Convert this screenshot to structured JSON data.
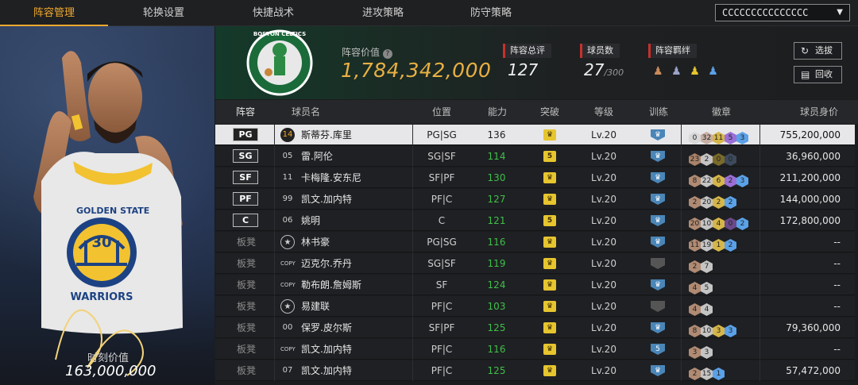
{
  "nav": {
    "tabs": [
      "阵容管理",
      "轮换设置",
      "快捷战术",
      "进攻策略",
      "防守策略"
    ],
    "active": 0,
    "team_select": "CCCCCCCCCCCCCCC"
  },
  "left_panel": {
    "moment_label": "时刻价值",
    "moment_value": "163,000,000"
  },
  "header": {
    "value_label": "阵容价值",
    "value": "1,784,342,000",
    "overall_label": "阵容总评",
    "overall": "127",
    "count_label": "球员数",
    "count": "27",
    "count_max": "/300",
    "chem_label": "阵容羁绊",
    "btn_pick": "选拔",
    "btn_recycle": "回收",
    "logo_text": "BOSTON CELTICS"
  },
  "columns": [
    "阵容",
    "球员名",
    "位置",
    "能力",
    "突破",
    "等级",
    "训练",
    "徽章",
    "球员身价"
  ],
  "rows": [
    {
      "slot": "PG",
      "type": "pos",
      "jersey": "14",
      "name": "斯蒂芬.库里",
      "pos": "PG|SG",
      "ability": "136",
      "ab_green": false,
      "bt": "♛",
      "level": "Lv.20",
      "train": "♛",
      "train_grey": false,
      "badges": [
        {
          "v": "0",
          "c": "#d8d8d8"
        },
        {
          "v": "32",
          "c": "#c9b0a4"
        },
        {
          "v": "11",
          "c": "#d6b648"
        },
        {
          "v": "5",
          "c": "#9b6fd6"
        },
        {
          "v": "3",
          "c": "#5aa1e8"
        }
      ],
      "worth": "755,200,000",
      "sel": true
    },
    {
      "slot": "SG",
      "type": "pos",
      "jersey": "05",
      "name": "雷.阿伦",
      "pos": "SG|SF",
      "ability": "114",
      "ab_green": true,
      "bt": "5",
      "level": "Lv.20",
      "train": "♛",
      "train_grey": false,
      "badges": [
        {
          "v": "23",
          "c": "#a8826a"
        },
        {
          "v": "2",
          "c": "#c4c4c4"
        },
        {
          "v": "0",
          "c": "#7a6a2a"
        },
        {
          "v": "0",
          "c": "#3c4a5c"
        }
      ],
      "worth": "36,960,000",
      "sel": false
    },
    {
      "slot": "SF",
      "type": "pos",
      "jersey": "11",
      "name": "卡梅隆.安东尼",
      "pos": "SF|PF",
      "ability": "130",
      "ab_green": true,
      "bt": "♛",
      "level": "Lv.20",
      "train": "♛",
      "train_grey": false,
      "badges": [
        {
          "v": "8",
          "c": "#b08a72"
        },
        {
          "v": "22",
          "c": "#c4c4c4"
        },
        {
          "v": "6",
          "c": "#d6b648"
        },
        {
          "v": "2",
          "c": "#9b6fd6"
        },
        {
          "v": "3",
          "c": "#5aa1e8"
        }
      ],
      "worth": "211,200,000",
      "sel": false
    },
    {
      "slot": "PF",
      "type": "pos",
      "jersey": "99",
      "name": "凯文.加内特",
      "pos": "PF|C",
      "ability": "127",
      "ab_green": true,
      "bt": "♛",
      "level": "Lv.20",
      "train": "♛",
      "train_grey": false,
      "badges": [
        {
          "v": "2",
          "c": "#b08a72"
        },
        {
          "v": "20",
          "c": "#c4c4c4"
        },
        {
          "v": "2",
          "c": "#d6b648"
        },
        {
          "v": "2",
          "c": "#5aa1e8"
        }
      ],
      "worth": "144,000,000",
      "sel": false
    },
    {
      "slot": "C",
      "type": "pos",
      "jersey": "06",
      "name": "姚明",
      "pos": "C",
      "ability": "121",
      "ab_green": true,
      "bt": "5",
      "level": "Lv.20",
      "train": "♛",
      "train_grey": false,
      "badges": [
        {
          "v": "20",
          "c": "#b08a72"
        },
        {
          "v": "10",
          "c": "#c4c4c4"
        },
        {
          "v": "4",
          "c": "#d6b648"
        },
        {
          "v": "0",
          "c": "#6a4a8a"
        },
        {
          "v": "2",
          "c": "#5aa1e8"
        }
      ],
      "worth": "172,800,000",
      "sel": false
    },
    {
      "slot": "板凳",
      "type": "bench",
      "jersey": "★",
      "name": "林书豪",
      "pos": "PG|SG",
      "ability": "116",
      "ab_green": true,
      "bt": "♛",
      "level": "Lv.20",
      "train": "♛",
      "train_grey": false,
      "badges": [
        {
          "v": "11",
          "c": "#b08a72"
        },
        {
          "v": "19",
          "c": "#c4c4c4"
        },
        {
          "v": "1",
          "c": "#d6b648"
        },
        {
          "v": "2",
          "c": "#5aa1e8"
        }
      ],
      "worth": "--",
      "sel": false
    },
    {
      "slot": "板凳",
      "type": "bench",
      "jersey": "COPY",
      "name": "迈克尔.乔丹",
      "pos": "SG|SF",
      "ability": "119",
      "ab_green": true,
      "bt": "♛",
      "level": "Lv.20",
      "train": "",
      "train_grey": true,
      "badges": [
        {
          "v": "2",
          "c": "#b08a72"
        },
        {
          "v": "7",
          "c": "#c4c4c4"
        }
      ],
      "worth": "--",
      "sel": false
    },
    {
      "slot": "板凳",
      "type": "bench",
      "jersey": "COPY",
      "name": "勒布朗.詹姆斯",
      "pos": "SF",
      "ability": "124",
      "ab_green": true,
      "bt": "♛",
      "level": "Lv.20",
      "train": "♛",
      "train_grey": false,
      "badges": [
        {
          "v": "4",
          "c": "#b08a72"
        },
        {
          "v": "5",
          "c": "#c4c4c4"
        }
      ],
      "worth": "--",
      "sel": false
    },
    {
      "slot": "板凳",
      "type": "bench",
      "jersey": "★",
      "name": "易建联",
      "pos": "PF|C",
      "ability": "103",
      "ab_green": true,
      "bt": "♛",
      "level": "Lv.20",
      "train": "",
      "train_grey": true,
      "badges": [
        {
          "v": "4",
          "c": "#b08a72"
        },
        {
          "v": "4",
          "c": "#c4c4c4"
        }
      ],
      "worth": "--",
      "sel": false
    },
    {
      "slot": "板凳",
      "type": "bench",
      "jersey": "00",
      "name": "保罗.皮尔斯",
      "pos": "SF|PF",
      "ability": "125",
      "ab_green": true,
      "bt": "♛",
      "level": "Lv.20",
      "train": "♛",
      "train_grey": false,
      "badges": [
        {
          "v": "8",
          "c": "#b08a72"
        },
        {
          "v": "10",
          "c": "#c4c4c4"
        },
        {
          "v": "3",
          "c": "#d6b648"
        },
        {
          "v": "3",
          "c": "#5aa1e8"
        }
      ],
      "worth": "79,360,000",
      "sel": false
    },
    {
      "slot": "板凳",
      "type": "bench",
      "jersey": "COPY",
      "name": "凯文.加内特",
      "pos": "PF|C",
      "ability": "116",
      "ab_green": true,
      "bt": "♛",
      "level": "Lv.20",
      "train": "5",
      "train_grey": false,
      "badges": [
        {
          "v": "3",
          "c": "#b08a72"
        },
        {
          "v": "3",
          "c": "#c4c4c4"
        }
      ],
      "worth": "--",
      "sel": false
    },
    {
      "slot": "板凳",
      "type": "bench",
      "jersey": "07",
      "name": "凯文.加内特",
      "pos": "PF|C",
      "ability": "125",
      "ab_green": true,
      "bt": "♛",
      "level": "Lv.20",
      "train": "♛",
      "train_grey": false,
      "badges": [
        {
          "v": "2",
          "c": "#b08a72"
        },
        {
          "v": "15",
          "c": "#c4c4c4"
        },
        {
          "v": "1",
          "c": "#5aa1e8"
        }
      ],
      "worth": "57,472,000",
      "sel": false
    }
  ]
}
